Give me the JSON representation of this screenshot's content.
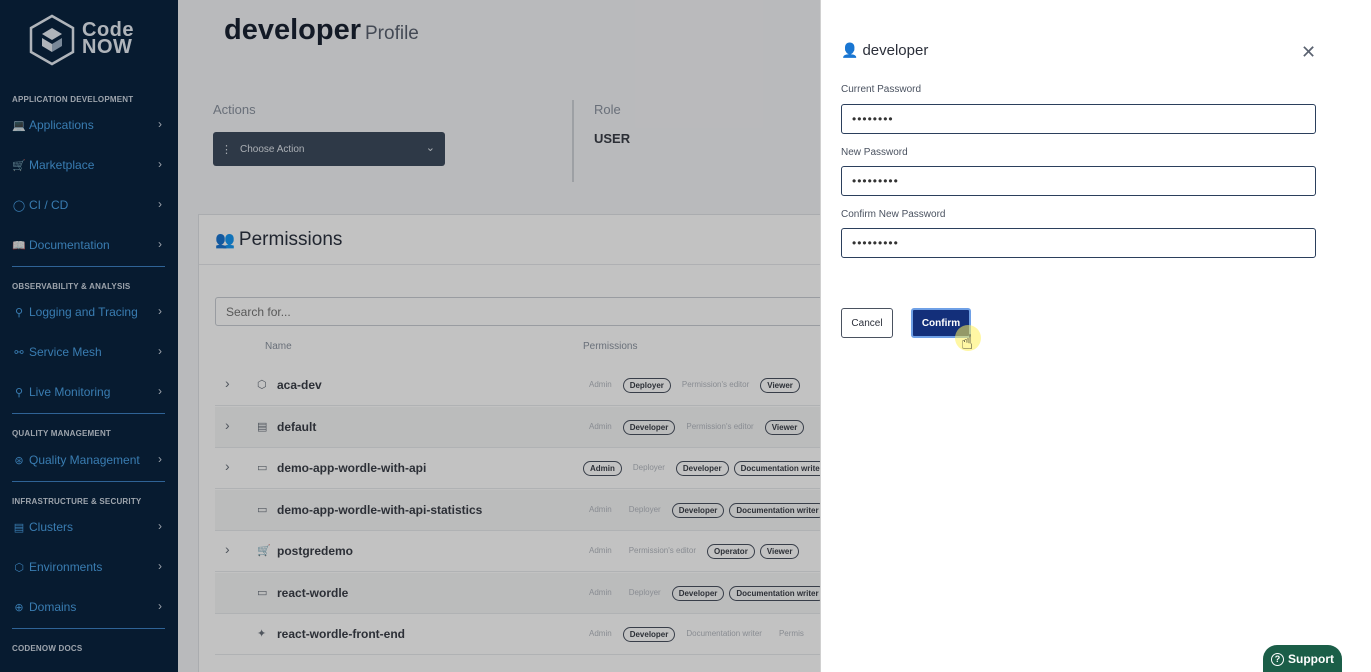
{
  "sidebar": {
    "brand_line1": "Code",
    "brand_line2": "NOW",
    "sections": [
      {
        "title": "APPLICATION DEVELOPMENT"
      },
      {
        "title": "OBSERVABILITY & ANALYSIS"
      },
      {
        "title": "QUALITY MANAGEMENT"
      },
      {
        "title": "INFRASTRUCTURE & SECURITY"
      },
      {
        "title": "CODENOW DOCS"
      }
    ],
    "items": [
      {
        "label": "Applications",
        "icon": "laptop-icon"
      },
      {
        "label": "Marketplace",
        "icon": "cart-icon"
      },
      {
        "label": "CI / CD",
        "icon": "circle-icon"
      },
      {
        "label": "Documentation",
        "icon": "book-icon"
      },
      {
        "label": "Logging and Tracing",
        "icon": "binoculars-icon"
      },
      {
        "label": "Service Mesh",
        "icon": "mesh-icon"
      },
      {
        "label": "Live Monitoring",
        "icon": "binoculars-icon"
      },
      {
        "label": "Quality Management",
        "icon": "badge-icon"
      },
      {
        "label": "Clusters",
        "icon": "server-icon"
      },
      {
        "label": "Environments",
        "icon": "cube-icon"
      },
      {
        "label": "Domains",
        "icon": "globe-icon"
      }
    ]
  },
  "page": {
    "title": "developer",
    "subtitle": "Profile",
    "actions_label": "Actions",
    "choose_action": "Choose Action",
    "role_label": "Role",
    "role_value": "USER"
  },
  "permissions": {
    "title": "Permissions",
    "search_placeholder": "Search for...",
    "col_name": "Name",
    "col_permissions": "Permissions",
    "rows": [
      {
        "name": "aca-dev",
        "expand": true,
        "icon": "cube-icon",
        "tags": [
          [
            "Admin",
            false
          ],
          [
            "Deployer",
            true
          ],
          [
            "Permission's editor",
            false
          ],
          [
            "Viewer",
            true
          ]
        ]
      },
      {
        "name": "default",
        "expand": true,
        "icon": "server-icon",
        "tags": [
          [
            "Admin",
            false
          ],
          [
            "Developer",
            true
          ],
          [
            "Permission's editor",
            false
          ],
          [
            "Viewer",
            true
          ]
        ]
      },
      {
        "name": "demo-app-wordle-with-api",
        "expand": true,
        "icon": "laptop-icon",
        "tags": [
          [
            "Admin",
            true
          ],
          [
            "Deployer",
            false
          ],
          [
            "Developer",
            true
          ],
          [
            "Documentation writer",
            true
          ]
        ]
      },
      {
        "name": "demo-app-wordle-with-api-statistics",
        "expand": false,
        "icon": "laptop-icon",
        "tags": [
          [
            "Admin",
            false
          ],
          [
            "Deployer",
            false
          ],
          [
            "Developer",
            true
          ],
          [
            "Documentation writer",
            true
          ]
        ]
      },
      {
        "name": "postgredemo",
        "expand": true,
        "icon": "cart-icon",
        "tags": [
          [
            "Admin",
            false
          ],
          [
            "Permission's editor",
            false
          ],
          [
            "Operator",
            true
          ],
          [
            "Viewer",
            true
          ]
        ]
      },
      {
        "name": "react-wordle",
        "expand": false,
        "icon": "laptop-icon",
        "tags": [
          [
            "Admin",
            false
          ],
          [
            "Deployer",
            false
          ],
          [
            "Developer",
            true
          ],
          [
            "Documentation writer",
            true
          ]
        ]
      },
      {
        "name": "react-wordle-front-end",
        "expand": false,
        "icon": "puzzle-icon",
        "tags": [
          [
            "Admin",
            false
          ],
          [
            "Developer",
            true
          ],
          [
            "Documentation writer",
            false
          ],
          [
            "Permis",
            false
          ]
        ]
      }
    ]
  },
  "modal": {
    "title": "developer",
    "current_label": "Current Password",
    "current_value": "••••••••",
    "new_label": "New Password",
    "new_value": "•••••••••",
    "confirm_label": "Confirm New Password",
    "confirm_value": "•••••••••",
    "cancel": "Cancel",
    "confirm": "Confirm"
  },
  "support": "Support",
  "colors": {
    "sidebar_bg": "#0a2440",
    "accent": "#132f7a",
    "support_bg": "#1b5e48"
  }
}
